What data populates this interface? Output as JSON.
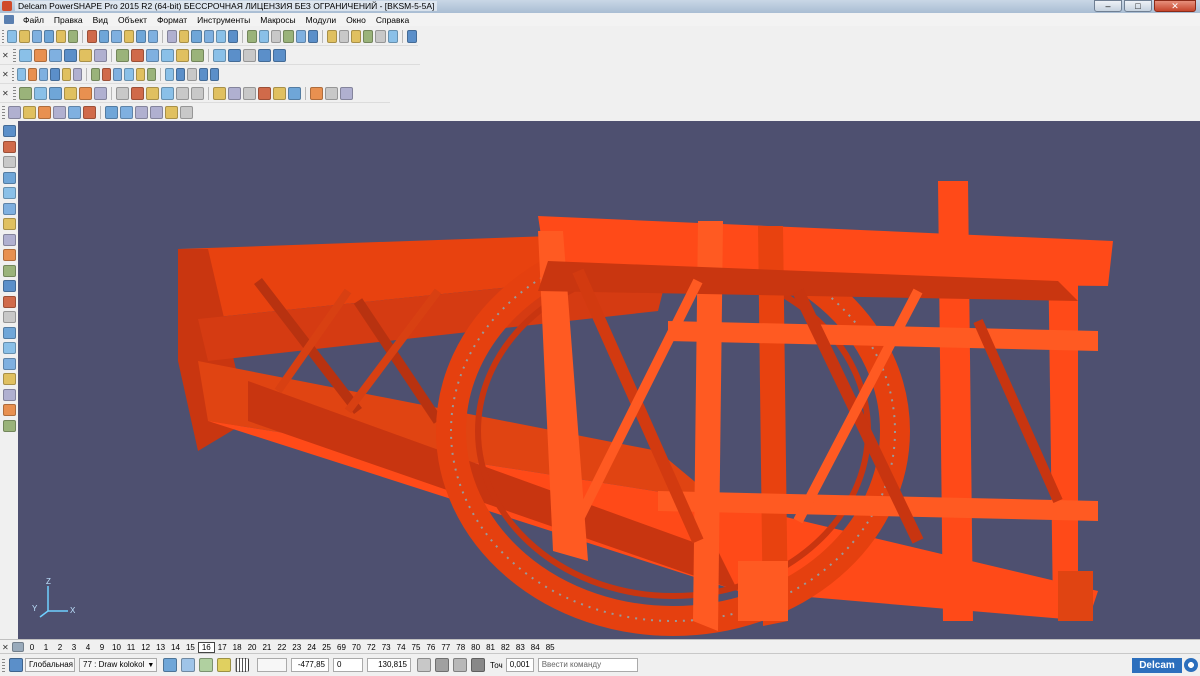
{
  "window": {
    "title": "Delcam PowerSHAPE Pro 2015 R2 (64-bit) БЕССРОЧНАЯ ЛИЦЕНЗИЯ БЕЗ ОГРАНИЧЕНИЙ - [BKSM-5-5A]",
    "minimize": "–",
    "maximize": "□",
    "close": "✕"
  },
  "menu": [
    "Файл",
    "Правка",
    "Вид",
    "Объект",
    "Формат",
    "Инструменты",
    "Макросы",
    "Модули",
    "Окно",
    "Справка"
  ],
  "toolbar1_icons": [
    "new-icon",
    "open-icon",
    "save-icon",
    "save-as-icon",
    "print-icon",
    "cut-icon",
    "copy-icon",
    "paste-icon",
    "delete-icon",
    "properties-icon",
    "select-icon",
    "zoom-in-icon",
    "zoom-out-icon",
    "zoom-fit-icon",
    "view-icon",
    "shade-icon",
    "light-icon",
    "undo-icon",
    "redo-icon",
    "repeat-icon",
    "workplane-icon",
    "point-icon",
    "line-icon",
    "circle-icon",
    "curve-icon",
    "text-icon",
    "dimension-icon",
    "surface-icon",
    "solid-icon",
    "render-icon",
    "tools-icon"
  ],
  "toolbar2_icons": [
    "box-icon",
    "cylinder-icon",
    "cone-icon",
    "sphere-icon",
    "torus-icon",
    "extrusion-icon",
    "revolution-icon",
    "boolean-add-icon",
    "boolean-subtract-icon",
    "fillet-icon",
    "chamfer-icon",
    "shell-icon",
    "pattern-icon",
    "mirror-icon",
    "feature-icon",
    "solid-tree-icon",
    "analyse-icon"
  ],
  "toolbar3_icons": [
    "view-top-icon",
    "view-front-icon",
    "view-right-icon",
    "view-iso-icon",
    "view-left-icon",
    "view-back-icon",
    "view-bottom-icon",
    "zoom-window-icon",
    "pan-icon",
    "rotate-icon",
    "wireframe-icon",
    "shaded-icon",
    "hidden-line-icon",
    "edges-icon",
    "section-icon",
    "measure-icon",
    "curvature-icon",
    "draft-icon",
    "normals-icon",
    "translucency-icon",
    "clip-icon"
  ],
  "toolbar4_icons": [
    "snap-icon",
    "grid-icon",
    "workplane-align-icon",
    "layer-icon",
    "material-icon",
    "texture-icon",
    "assembly-icon",
    "component-icon",
    "constraint-icon",
    "explode-icon",
    "animate-icon",
    "export-icon"
  ],
  "left_toolbar_icons": [
    "select-arrow-icon",
    "edit-icon",
    "solid-icon",
    "wireframe-icon",
    "copy-icon",
    "move-icon",
    "scale-icon",
    "rotate-icon",
    "mirror-icon",
    "offset-icon",
    "surface-icon",
    "trim-icon",
    "extend-icon",
    "blend-icon",
    "fillet-icon",
    "analyse-icon",
    "info-icon",
    "layer-icon",
    "level-icon",
    "material-icon"
  ],
  "axis": {
    "x": "X",
    "y": "Y",
    "z": "Z"
  },
  "levels": [
    "0",
    "1",
    "2",
    "3",
    "4",
    "9",
    "10",
    "11",
    "12",
    "13",
    "14",
    "15",
    "16",
    "17",
    "18",
    "20",
    "21",
    "22",
    "23",
    "24",
    "25",
    "69",
    "70",
    "72",
    "73",
    "74",
    "75",
    "76",
    "77",
    "78",
    "80",
    "81",
    "82",
    "83",
    "84",
    "85"
  ],
  "active_level": "16",
  "status": {
    "workplane": "Глобальная",
    "layer": "77 : Draw kolokol",
    "x": "-477,85",
    "y": "0",
    "z": "130,815",
    "tolerance_label": "Точ",
    "tolerance": "0,001",
    "command_placeholder": "Ввести команду",
    "brand": "Delcam"
  },
  "colors": {
    "model": "#ff4a18",
    "viewport_bg": "#4e5070",
    "titlebar": "#b8c9dc"
  }
}
